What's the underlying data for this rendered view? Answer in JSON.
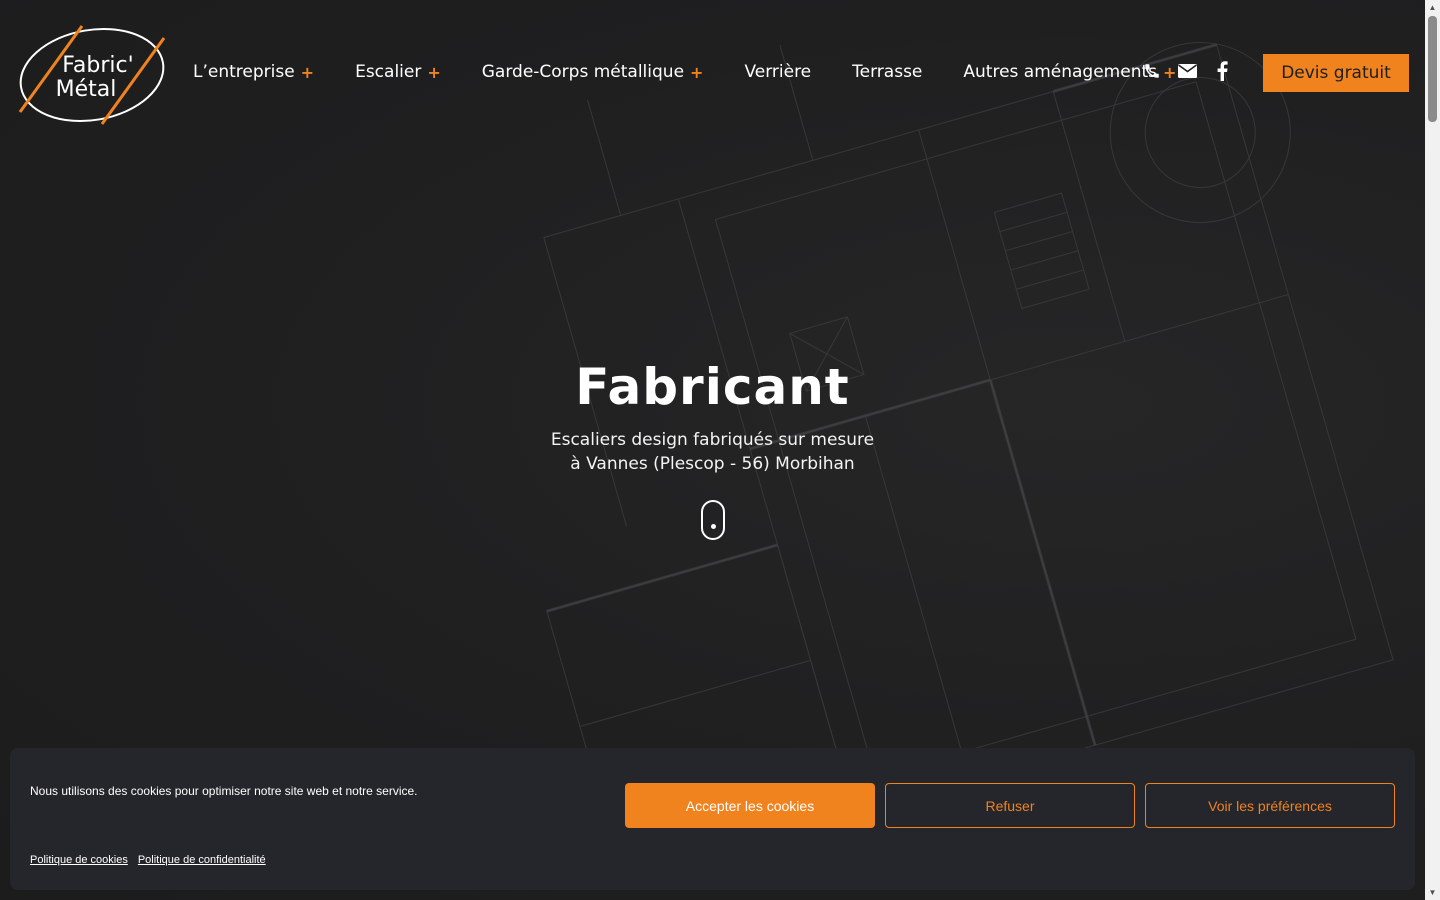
{
  "brand": {
    "logo_line1": "Fabric'",
    "logo_line2": "Métal",
    "accent_color": "#f0831e"
  },
  "nav": {
    "items": [
      {
        "label": "L’entreprise",
        "has_submenu": true
      },
      {
        "label": "Escalier",
        "has_submenu": true
      },
      {
        "label": "Garde-Corps métallique",
        "has_submenu": true
      },
      {
        "label": "Verrière",
        "has_submenu": false
      },
      {
        "label": "Terrasse",
        "has_submenu": false
      },
      {
        "label": "Autres aménagements",
        "has_submenu": true
      }
    ],
    "submenu_symbol": "+",
    "icons": [
      "phone-icon",
      "mail-icon",
      "facebook-icon"
    ],
    "cta_label": "Devis gratuit"
  },
  "hero": {
    "title": "Fabricant",
    "subtitle_line1": "Escaliers design fabriqués sur mesure",
    "subtitle_line2": "à Vannes (Plescop - 56) Morbihan"
  },
  "cookie_banner": {
    "message": "Nous utilisons des cookies pour optimiser notre site web et notre service.",
    "accept_label": "Accepter les cookies",
    "refuse_label": "Refuser",
    "preferences_label": "Voir les préférences",
    "links": [
      "Politique de cookies",
      "Politique de confidentialité"
    ]
  }
}
